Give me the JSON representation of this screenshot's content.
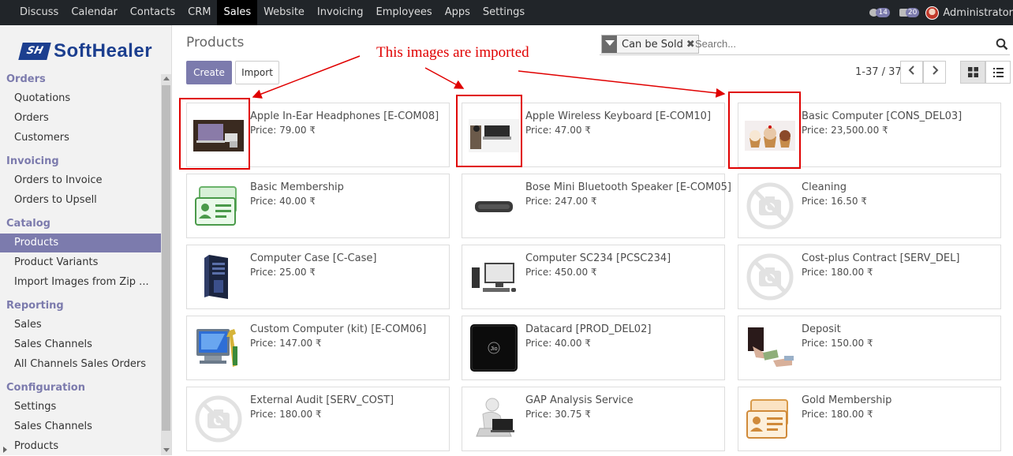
{
  "topnav": {
    "menu": [
      "Discuss",
      "Calendar",
      "Contacts",
      "CRM",
      "Sales",
      "Website",
      "Invoicing",
      "Employees",
      "Apps",
      "Settings"
    ],
    "active": "Sales",
    "activity_count": "14",
    "message_count": "20",
    "user": "Administrator"
  },
  "sidebar": {
    "logo_mark": "SH",
    "logo_text": "SoftHealer",
    "items": [
      {
        "type": "head",
        "label": "Orders"
      },
      {
        "type": "link",
        "label": "Quotations"
      },
      {
        "type": "link",
        "label": "Orders"
      },
      {
        "type": "link",
        "label": "Customers"
      },
      {
        "type": "head",
        "label": "Invoicing"
      },
      {
        "type": "link",
        "label": "Orders to Invoice"
      },
      {
        "type": "link",
        "label": "Orders to Upsell"
      },
      {
        "type": "head",
        "label": "Catalog"
      },
      {
        "type": "link",
        "label": "Products",
        "active": true
      },
      {
        "type": "link",
        "label": "Product Variants"
      },
      {
        "type": "link",
        "label": "Import Images from Zip ..."
      },
      {
        "type": "head",
        "label": "Reporting"
      },
      {
        "type": "link",
        "label": "Sales"
      },
      {
        "type": "link",
        "label": "Sales Channels"
      },
      {
        "type": "link",
        "label": "All Channels Sales Orders"
      },
      {
        "type": "head",
        "label": "Configuration"
      },
      {
        "type": "link",
        "label": "Settings"
      },
      {
        "type": "link",
        "label": "Sales Channels"
      },
      {
        "type": "link",
        "label": "Products"
      }
    ]
  },
  "control": {
    "title": "Products",
    "create_label": "Create",
    "import_label": "Import",
    "facet": "Can be Sold",
    "search_placeholder": "Search...",
    "pager": "1-37 / 37"
  },
  "annotation": "This images are imported",
  "products": [
    {
      "name": "Apple In-Ear Headphones [E-COM08]",
      "price": "Price: 79.00 ₹",
      "icon": "laptop-photo"
    },
    {
      "name": "Apple Wireless Keyboard [E-COM10]",
      "price": "Price: 47.00 ₹",
      "icon": "keyboard-photo"
    },
    {
      "name": "Basic Computer [CONS_DEL03]",
      "price": "Price: 23,500.00 ₹",
      "icon": "cupcakes-photo"
    },
    {
      "name": "Basic Membership",
      "price": "Price: 40.00 ₹",
      "icon": "membership-card-icon"
    },
    {
      "name": "Bose Mini Bluetooth Speaker [E-COM05]",
      "price": "Price: 247.00 ₹",
      "icon": "speaker-photo"
    },
    {
      "name": "Cleaning",
      "price": "Price: 16.50 ₹",
      "icon": "no-image-camera-icon"
    },
    {
      "name": "Computer Case [C-Case]",
      "price": "Price: 25.00 ₹",
      "icon": "pc-tower-icon"
    },
    {
      "name": "Computer SC234 [PCSC234]",
      "price": "Price: 450.00 ₹",
      "icon": "desktop-computer-icon"
    },
    {
      "name": "Cost-plus Contract [SERV_DEL]",
      "price": "Price: 180.00 ₹",
      "icon": "no-image-camera-icon"
    },
    {
      "name": "Custom Computer (kit) [E-COM06]",
      "price": "Price: 147.00 ₹",
      "icon": "computer-tools-icon"
    },
    {
      "name": "Datacard [PROD_DEL02]",
      "price": "Price: 40.00 ₹",
      "icon": "jio-datacard-photo"
    },
    {
      "name": "Deposit",
      "price": "Price: 150.00 ₹",
      "icon": "cash-handover-photo"
    },
    {
      "name": "External Audit [SERV_COST]",
      "price": "Price: 180.00 ₹",
      "icon": "no-image-camera-icon"
    },
    {
      "name": "GAP Analysis Service",
      "price": "Price: 30.75 ₹",
      "icon": "person-laptop-icon"
    },
    {
      "name": "Gold Membership",
      "price": "Price: 180.00 ₹",
      "icon": "gold-card-icon"
    }
  ]
}
